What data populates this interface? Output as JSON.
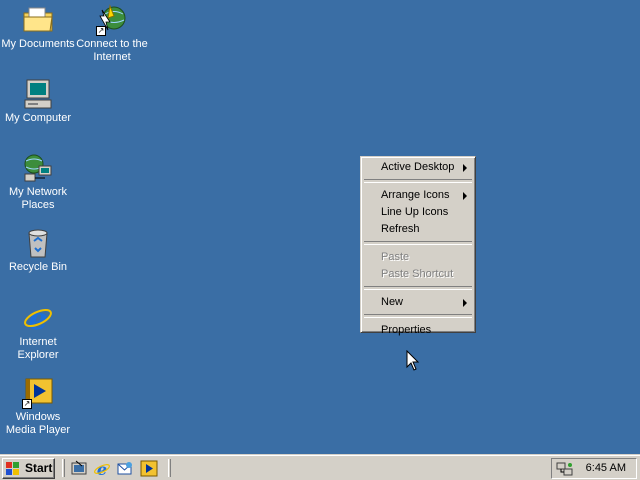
{
  "desktop": {
    "background_color": "#3a6ea5",
    "icons": [
      {
        "label": "My Documents",
        "icon": "folder-icon"
      },
      {
        "label": "Connect to the Internet",
        "icon": "connect-internet-icon"
      },
      {
        "label": "My Computer",
        "icon": "computer-icon"
      },
      {
        "label": "My Network Places",
        "icon": "network-icon"
      },
      {
        "label": "Recycle Bin",
        "icon": "recycle-bin-icon"
      },
      {
        "label": "Internet Explorer",
        "icon": "internet-explorer-icon"
      },
      {
        "label": "Windows Media Player",
        "icon": "media-player-icon"
      }
    ]
  },
  "context_menu": {
    "items": [
      {
        "label": "Active Desktop",
        "submenu": true,
        "disabled": false
      },
      {
        "label": "Arrange Icons",
        "submenu": true,
        "disabled": false
      },
      {
        "label": "Line Up Icons",
        "submenu": false,
        "disabled": false
      },
      {
        "label": "Refresh",
        "submenu": false,
        "disabled": false
      },
      {
        "label": "Paste",
        "submenu": false,
        "disabled": true
      },
      {
        "label": "Paste Shortcut",
        "submenu": false,
        "disabled": true
      },
      {
        "label": "New",
        "submenu": true,
        "disabled": false
      },
      {
        "label": "Properties",
        "submenu": false,
        "disabled": false
      }
    ]
  },
  "taskbar": {
    "start_label": "Start",
    "quick_launch": [
      "show-desktop-icon",
      "internet-explorer-icon",
      "outlook-express-icon",
      "media-player-icon"
    ],
    "tray": {
      "clock": "6:45 AM",
      "icon": "network-connection-icon"
    }
  }
}
